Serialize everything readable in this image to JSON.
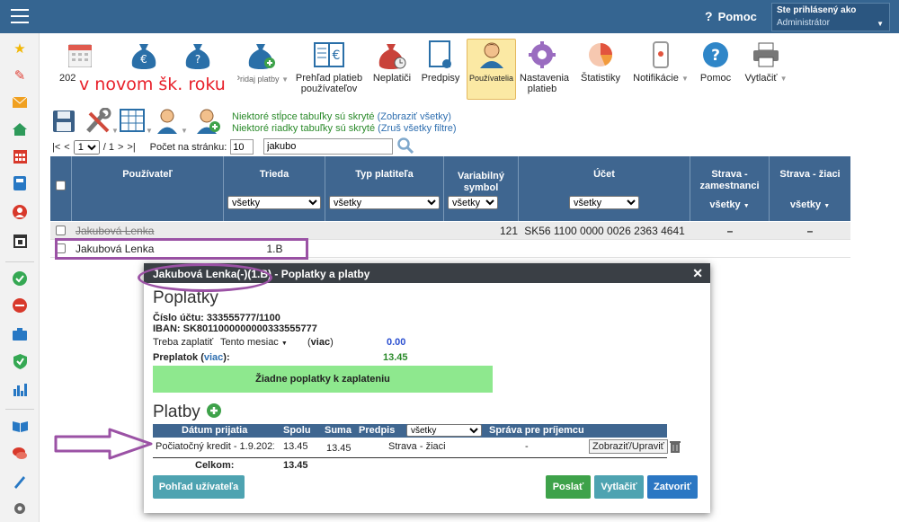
{
  "topbar": {
    "help_label": "Pomoc",
    "user_line1": "Ste prihlásený ako",
    "user_line2": "Administrátor"
  },
  "sidebar": {
    "icons": [
      "star-icon",
      "magic-wand-icon",
      "envelope-icon",
      "home-icon",
      "calendar-icon",
      "book-icon",
      "person-icon",
      "calendar-day-icon",
      "check-circle-icon",
      "no-entry-icon",
      "briefcase-icon",
      "shield-check-icon",
      "bar-chart-icon",
      "open-book-icon",
      "chat-icon",
      "pen-icon",
      "gear-icon"
    ]
  },
  "toolbar": {
    "items": [
      {
        "id": "year",
        "label": "202"
      },
      {
        "id": "add-payments",
        "label": "Pridaj platby"
      },
      {
        "id": "overview",
        "label": "Prehľad platieb používateľov"
      },
      {
        "id": "debtors",
        "label": "Neplatiči"
      },
      {
        "id": "prescriptions",
        "label": "Predpisy"
      },
      {
        "id": "users",
        "label": "Používatelia"
      },
      {
        "id": "payment-settings",
        "label": "Nastavenia platieb"
      },
      {
        "id": "statistics",
        "label": "Štatistiky"
      },
      {
        "id": "notifications",
        "label": "Notifikácie"
      },
      {
        "id": "help",
        "label": "Pomoc"
      },
      {
        "id": "print",
        "label": "Vytlačiť"
      }
    ],
    "overlay_text": "v novom šk. roku"
  },
  "hints": {
    "columns_hidden": "Niektoré stĺpce tabuľky sú skryté",
    "show_all": "(Zobraziť všetky)",
    "rows_hidden": "Niektoré riadky tabuľky sú skryté",
    "cancel_filters": "(Zruš všetky filtre)"
  },
  "pager": {
    "first": "|<",
    "prev": "<",
    "page": "1",
    "of": "/ 1",
    "next": ">",
    "last": ">|",
    "per_page_label": "Počet na stránku:",
    "per_page_value": "10",
    "search_value": "jakubo"
  },
  "table": {
    "headers": {
      "user": "Používateľ",
      "class": "Trieda",
      "payer_type": "Typ platiteľa",
      "var_symbol": "Variabilný symbol",
      "account": "Účet",
      "meals_staff": "Strava - zamestnanci",
      "meals_pupils": "Strava - žiaci"
    },
    "filter_all": "všetky",
    "rows": [
      {
        "user": "Jakubová Lenka",
        "class": "",
        "payer_type": "",
        "var_symbol": "121",
        "account": "SK56 1100 0000 0026 2363 4641",
        "meals_staff": "–",
        "meals_pupils": "–"
      },
      {
        "user": "Jakubová Lenka",
        "class": "1.B",
        "payer_type": "",
        "var_symbol": "",
        "account": "",
        "meals_staff": "",
        "meals_pupils": ""
      }
    ]
  },
  "modal": {
    "title": "Jakubová Lenka(-)(1.B) - Poplatky a platby",
    "fees_title": "Poplatky",
    "account_label": "Číslo účtu:",
    "account_value": "333555777/1100",
    "iban_label": "IBAN:",
    "iban_value": "SK8011000000000333555777",
    "to_pay_label": "Treba zaplatiť",
    "period_value": "Tento mesiac",
    "more": "viac",
    "to_pay_value": "0.00",
    "overpay_label": "Preplatok",
    "overpay_value": "13.45",
    "no_fees": "Žiadne poplatky k zaplateniu",
    "payments_title": "Platby",
    "pay_headers": {
      "date": "Dátum prijatia",
      "total": "Spolu",
      "amount": "Suma",
      "prescription": "Predpis",
      "filter": "všetky",
      "message": "Správa pre príjemcu"
    },
    "pay_row": {
      "date": "Počiatočný kredit - 1.9.2021",
      "total": "13.45",
      "amount": "13.45",
      "prescription": "Strava - žiaci",
      "message": "-",
      "view_button": "Zobraziť/Upraviť"
    },
    "sum_label": "Celkom:",
    "sum_value": "13.45",
    "btn_user_view": "Pohľad užívateľa",
    "btn_send": "Poslať",
    "btn_print": "Vytlačiť",
    "btn_close": "Zatvoriť"
  },
  "colors": {
    "topbar": "#356591",
    "table_header": "#3f6690",
    "modal_header": "#3a3f45",
    "annotation": "#9b52a5",
    "no_fees_bg": "#8ee88e",
    "overlay_text": "#e8202a"
  }
}
